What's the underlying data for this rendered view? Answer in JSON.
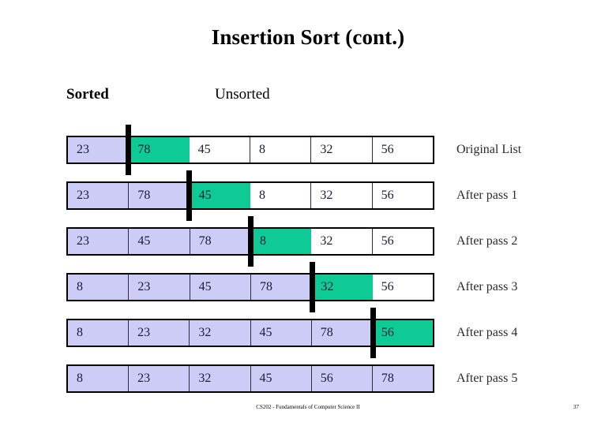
{
  "slide": {
    "title": "Insertion Sort (cont.)",
    "headers": {
      "sorted": "Sorted",
      "unsorted": "Unsorted"
    },
    "footer": {
      "course": "CS202 - Fundamentals of Computer Science II",
      "page_number": "37"
    }
  },
  "colors": {
    "sorted_fill": "#ccccf7",
    "current_fill": "#0ecb96",
    "unsorted_fill": "#ffffff",
    "border": "#000000",
    "marker": "#000000",
    "text": "#1b1b3a"
  },
  "chart_data": {
    "type": "table",
    "title": "Insertion Sort (cont.)",
    "column_headers": [
      "Sorted",
      "Unsorted"
    ],
    "row_labels": [
      "Original List",
      "After pass 1",
      "After pass 2",
      "After pass 3",
      "After pass 4",
      "After pass 5"
    ],
    "columns": 6,
    "rows": [
      {
        "label": "Original List",
        "values": [
          "23",
          "78",
          "45",
          "8",
          "32",
          "56"
        ],
        "states": [
          "sorted",
          "current",
          "unsorted",
          "unsorted",
          "unsorted",
          "unsorted"
        ],
        "marker_after_index": 1
      },
      {
        "label": "After pass 1",
        "values": [
          "23",
          "78",
          "45",
          "8",
          "32",
          "56"
        ],
        "states": [
          "sorted",
          "sorted",
          "current",
          "unsorted",
          "unsorted",
          "unsorted"
        ],
        "marker_after_index": 2
      },
      {
        "label": "After pass 2",
        "values": [
          "23",
          "45",
          "78",
          "8",
          "32",
          "56"
        ],
        "states": [
          "sorted",
          "sorted",
          "sorted",
          "current",
          "unsorted",
          "unsorted"
        ],
        "marker_after_index": 3
      },
      {
        "label": "After pass 3",
        "values": [
          "8",
          "23",
          "45",
          "78",
          "32",
          "56"
        ],
        "states": [
          "sorted",
          "sorted",
          "sorted",
          "sorted",
          "current",
          "unsorted"
        ],
        "marker_after_index": 4
      },
      {
        "label": "After pass 4",
        "values": [
          "8",
          "23",
          "32",
          "45",
          "78",
          "56"
        ],
        "states": [
          "sorted",
          "sorted",
          "sorted",
          "sorted",
          "sorted",
          "current"
        ],
        "marker_after_index": 5
      },
      {
        "label": "After pass 5",
        "values": [
          "8",
          "23",
          "32",
          "45",
          "56",
          "78"
        ],
        "states": [
          "sorted",
          "sorted",
          "sorted",
          "sorted",
          "sorted",
          "sorted"
        ],
        "marker_after_index": null
      }
    ]
  }
}
